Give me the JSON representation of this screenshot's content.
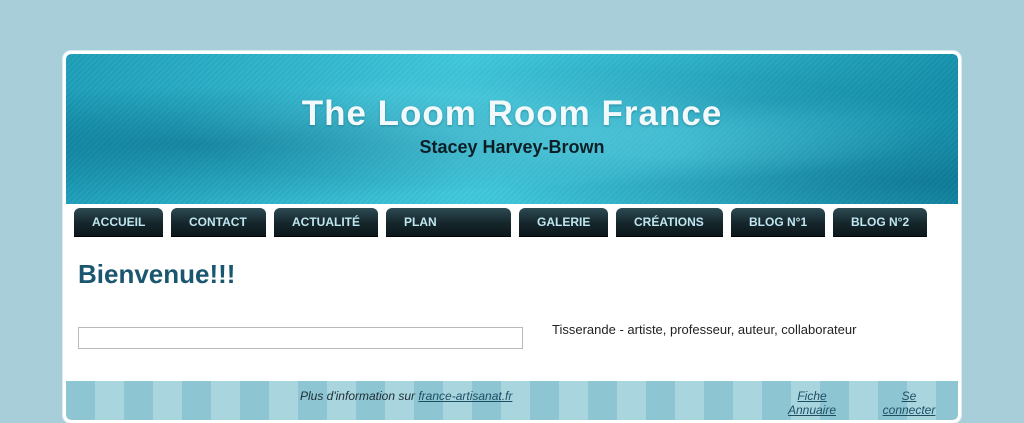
{
  "header": {
    "title": "The Loom Room France",
    "subtitle": "Stacey Harvey-Brown"
  },
  "nav": {
    "items": [
      {
        "label": "ACCUEIL"
      },
      {
        "label": "CONTACT"
      },
      {
        "label": "ACTUALITÉ"
      },
      {
        "label": "PLAN"
      },
      {
        "label": "GALERIE"
      },
      {
        "label": "CRÉATIONS"
      },
      {
        "label": "BLOG N°1"
      },
      {
        "label": "BLOG N°2"
      }
    ]
  },
  "main": {
    "heading": "Bienvenue!!!",
    "description": "Tisserande - artiste, professeur, auteur, collaborateur"
  },
  "footer": {
    "info_prefix": "Plus d'information sur ",
    "info_link": "france-artisanat.fr",
    "directory_line1": "Fiche",
    "directory_line2": "Annuaire",
    "login_line1": "Se",
    "login_line2": "connecter"
  },
  "colors": {
    "background": "#a8cfd9",
    "nav_tab": "#15262b",
    "nav_text": "#bfe6f0",
    "heading": "#1a5670"
  }
}
